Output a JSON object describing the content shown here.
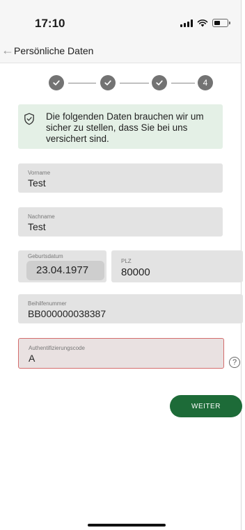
{
  "status_bar": {
    "time": "17:10",
    "signal_icon": "signal-bars",
    "wifi_icon": "wifi",
    "battery_icon": "battery",
    "battery_level": 0.45
  },
  "nav": {
    "back_icon": "arrow-left",
    "title": "Persönliche Daten"
  },
  "stepper": {
    "steps": [
      {
        "state": "completed",
        "icon": "check"
      },
      {
        "state": "completed",
        "icon": "check"
      },
      {
        "state": "completed",
        "icon": "check"
      },
      {
        "state": "current",
        "label": "4"
      }
    ]
  },
  "info": {
    "icon": "shield-check",
    "text": "Die folgenden Daten brauchen wir um sicher zu stellen, dass Sie bei uns versichert sind.",
    "background": "#e4f0e6"
  },
  "form": {
    "vorname": {
      "label": "Vorname",
      "value": "Test"
    },
    "nachname": {
      "label": "Nachname",
      "value": "Test"
    },
    "geburtsdatum": {
      "label": "Geburtsdatum",
      "value": "23.04.1977"
    },
    "plz": {
      "label": "PLZ",
      "value": "80000"
    },
    "beihilfenummer": {
      "label": "Beihilfenummer",
      "value": "BB000000038387"
    },
    "authentifizierungscode": {
      "label": "Authentifizierungscode",
      "value": "A",
      "state": "error"
    }
  },
  "help": {
    "icon": "question-circle",
    "label": "?"
  },
  "actions": {
    "weiter_label": "WEITER",
    "primary_color": "#1d6b38"
  }
}
